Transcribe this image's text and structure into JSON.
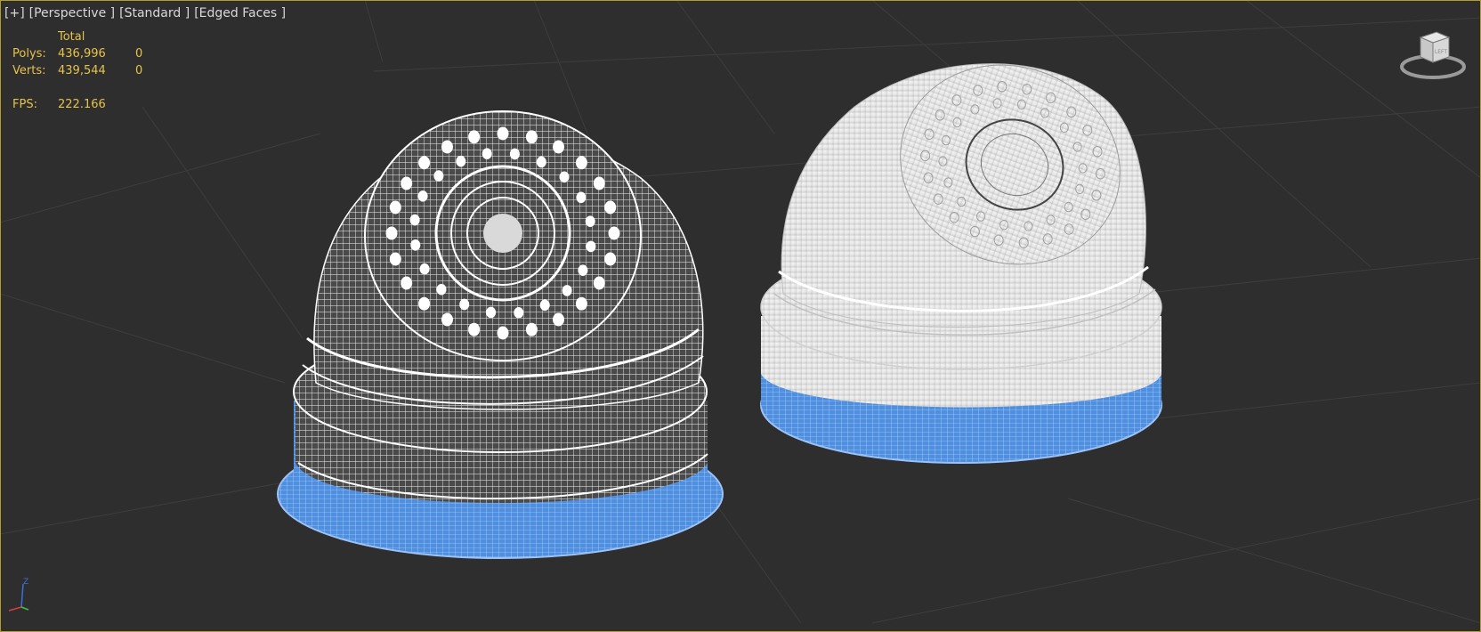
{
  "viewport": {
    "labels": [
      "[+]",
      "[Perspective ]",
      "[Standard ]",
      "[Edged Faces ]"
    ]
  },
  "stats": {
    "header": "Total",
    "polys_label": "Polys:",
    "polys_total": "436,996",
    "polys_selected": "0",
    "verts_label": "Verts:",
    "verts_total": "439,544",
    "verts_selected": "0",
    "fps_label": "FPS:",
    "fps_value": "222.166"
  },
  "viewcube": {
    "face_label": "LEFT",
    "icon": "viewcube-icon"
  },
  "axis": {
    "z_label": "Z",
    "icon": "axis-tripod-icon"
  },
  "colors": {
    "background": "#2e2e2e",
    "grid": "#3c3c3c",
    "viewport_border": "#b59a2c",
    "stats_text": "#e6c34a",
    "label_text": "#d8d8d8",
    "base_ring_blue": "#4f8fe0",
    "wire_white": "#ffffff",
    "shaded_white": "#e8e8e8"
  }
}
